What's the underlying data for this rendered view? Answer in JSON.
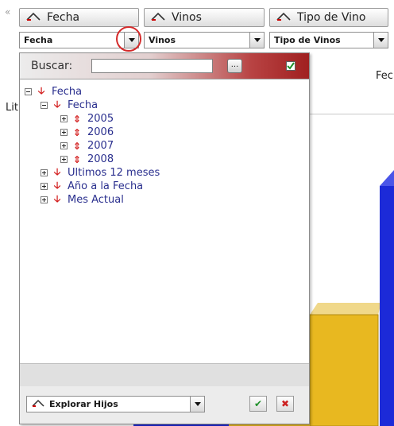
{
  "header": {
    "collapse_glyph": "«",
    "buttons": [
      {
        "label": "Fecha",
        "icon": "triangle-up-icon"
      },
      {
        "label": "Vinos",
        "icon": "triangle-up-icon"
      },
      {
        "label": "Tipo de Vino",
        "icon": "triangle-up-icon"
      }
    ]
  },
  "dropdowns": [
    {
      "value": "Fecha"
    },
    {
      "value": "Vinos"
    },
    {
      "value": "Tipo de Vinos"
    }
  ],
  "background": {
    "right_label": "Fec",
    "left_label": "Lit",
    "bar_colors": {
      "gold": "#e8b820",
      "gold_top": "#f0d88a",
      "blue": "#1c2ad8"
    }
  },
  "popup": {
    "search_label": "Buscar:",
    "search_value": "",
    "browse_label": "...",
    "tree": [
      {
        "label": "Fecha",
        "level": 0,
        "box": "minus",
        "arrow": "down"
      },
      {
        "label": "Fecha",
        "level": 1,
        "box": "minus",
        "arrow": "down"
      },
      {
        "label": "2005",
        "level": 2,
        "box": "plus",
        "arrow": "updown"
      },
      {
        "label": "2006",
        "level": 2,
        "box": "plus",
        "arrow": "updown"
      },
      {
        "label": "2007",
        "level": 2,
        "box": "plus",
        "arrow": "updown"
      },
      {
        "label": "2008",
        "level": 2,
        "box": "plus",
        "arrow": "updown"
      },
      {
        "label": "Ultimos 12 meses",
        "level": 1,
        "box": "plus",
        "arrow": "down"
      },
      {
        "label": "Año a la Fecha",
        "level": 1,
        "box": "plus",
        "arrow": "down"
      },
      {
        "label": "Mes Actual",
        "level": 1,
        "box": "plus",
        "arrow": "down"
      }
    ],
    "footer": {
      "explore_label": "Explorar Hijos",
      "accept_glyph": "✔",
      "cancel_glyph": "✖"
    },
    "accent_color": "#a02020"
  }
}
